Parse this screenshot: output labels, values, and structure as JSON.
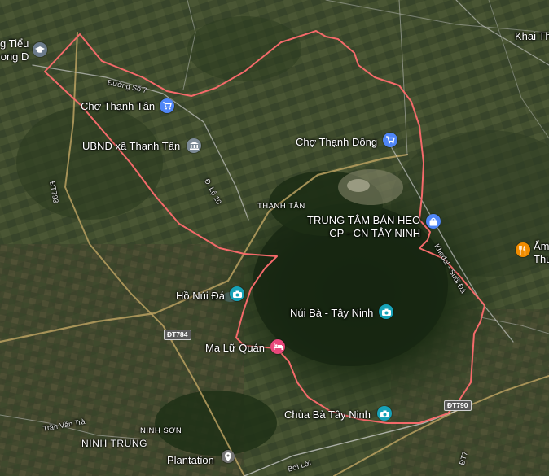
{
  "colors": {
    "boundary": "#f46a6a",
    "shopping_pin": "#4f86f7",
    "government_pin": "#7d8b97",
    "attraction_pin": "#17a2b8",
    "lodging_pin": "#e8477b",
    "food_pin": "#f08c00",
    "school_pin": "#6b7b8c",
    "place_pin": "#757575"
  },
  "pois": [
    {
      "id": "cho-thanh-tan",
      "label": "Chợ Thạnh Tân",
      "icon": "shopping-cart-icon"
    },
    {
      "id": "ubnd-xa-thanh-tan",
      "label": "UBND xã Thạnh Tân",
      "icon": "government-building-icon"
    },
    {
      "id": "cho-thanh-dong",
      "label": "Chợ Thạnh Đông",
      "icon": "shopping-cart-icon"
    },
    {
      "id": "trung-tam-ban-heo",
      "label_line1": "TRUNG TÂM BÁN HEO",
      "label_line2": "CP - CN TÂY NINH",
      "icon": "shopping-bag-icon"
    },
    {
      "id": "ho-nui-da",
      "label": "Hồ Núi Đá",
      "icon": "camera-icon"
    },
    {
      "id": "nui-ba-tay-ninh",
      "label": "Núi Bà - Tây Ninh",
      "icon": "camera-icon"
    },
    {
      "id": "ma-lu-quan",
      "label": "Ma Lữ Quán",
      "icon": "bed-icon"
    },
    {
      "id": "chua-ba-tay-ninh",
      "label": "Chùa Bà Tây Ninh",
      "icon": "camera-icon"
    },
    {
      "id": "plantation",
      "label": "Plantation",
      "icon": "place-pin-icon"
    },
    {
      "id": "am-thuc",
      "label_line1": "Ẩm",
      "label_line2": "Thu",
      "icon": "fork-knife-icon"
    },
    {
      "id": "truong-tieu-hoc",
      "label_line1": "g Tiểu",
      "label_line2": "ong D",
      "icon": "school-icon"
    }
  ],
  "areas": {
    "thanh_tan": "THẠNH TÂN",
    "ninh_son": "NINH SƠN",
    "ninh_trung": "NINH TRUNG",
    "khai_th": "Khai Th"
  },
  "roads": {
    "duong_so_7": "Đường Số 7",
    "d_lo_10": "Đ. Lộ 10",
    "dt_793": "ĐT793",
    "khedol_suoi_da": "Khedol - Suối Đá",
    "tran_van_tra": "Trần Văn Trà",
    "boi_loi": "Bời Lời",
    "dt_784": "ĐT784",
    "dt_790": "ĐT790",
    "edge_label": "ĐT7"
  }
}
